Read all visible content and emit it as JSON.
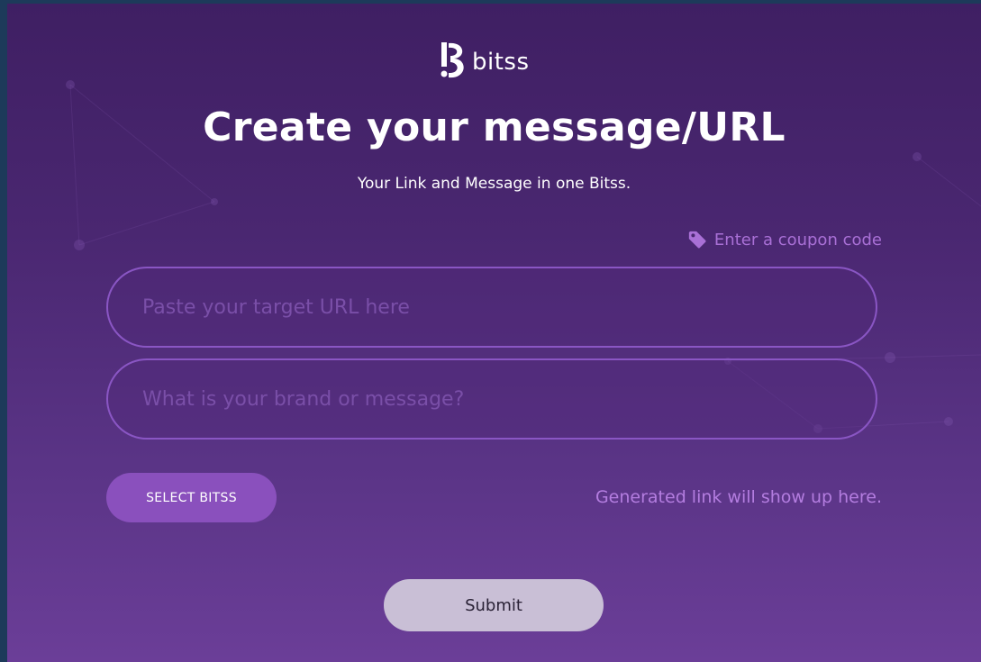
{
  "brand": {
    "logo_text": "bitss",
    "logo_icon": "bitss-b-icon"
  },
  "hero": {
    "title": "Create your message/URL",
    "subtitle": "Your Link and Message in one Bitss."
  },
  "coupon": {
    "icon": "tag-icon",
    "label": "Enter a coupon code"
  },
  "form": {
    "url_input": {
      "value": "",
      "placeholder": "Paste your target URL here"
    },
    "brand_input": {
      "value": "",
      "placeholder": "What is your brand or message?"
    },
    "select_button_label": "SELECT BITSS",
    "generated_link_text": "Generated link will show up here.",
    "submit_label": "Submit"
  },
  "colors": {
    "background_top": "#3f1f63",
    "background_bottom": "#6b3e98",
    "accent": "#8a50bd",
    "link_text": "#b47de0",
    "submit_bg": "#c9bfd6"
  }
}
